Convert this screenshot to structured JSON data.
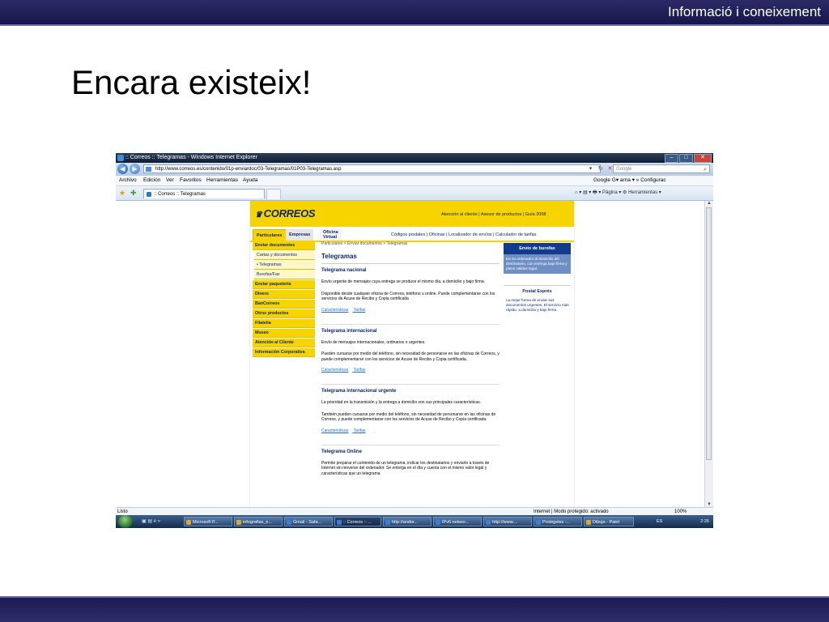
{
  "slide": {
    "header_title": "Informació i coneixement",
    "heading": "Encara existeix!"
  },
  "window": {
    "title": ":: Correos :: Telegramas - Windows Internet Explorer",
    "url": "http://www.correos.es/contenido/01p-enviardoc/03-Telegramas/01P03-Telegramas.asp",
    "search_placeholder": "Google"
  },
  "menu": {
    "items": [
      "Archivo",
      "Edición",
      "Ver",
      "Favoritos",
      "Herramientas",
      "Ayuda"
    ],
    "google_bar": "Google  G▾ arna ▾  »  Configurac"
  },
  "tab": {
    "label": ":: Correos :: Telegramas"
  },
  "command_bar": {
    "text": "⌂ ▾  ▤ ▾  🖶 ▾  Página ▾  ⚙ Herramientas ▾"
  },
  "correos": {
    "logo": "CORREOS",
    "top_links": "Atención al cliente  |  Asesor de productos  |  Guía 2008",
    "tabs": {
      "particulares": "Particulares",
      "empresas": "Empresas",
      "oficina_virtual_1": "Oficina",
      "oficina_virtual_2": "Virtual"
    },
    "sub_links": "Códigos postales  |  Oficinas  |  Localizador de envíos  |  Calculador de tarifas",
    "left_menu": [
      "Enviar documentos",
      "Cartas y documentos",
      "• Telegramas",
      "Burofax/Fax",
      "Enviar paquetería",
      "Dinero",
      "BanCorreos",
      "Otros productos",
      "Filatelia",
      "Museo",
      "Atención al Cliente",
      "Información Corporativa"
    ],
    "breadcrumb": "Particulares > Enviar documentos > Telegramas",
    "page_title": "Telegramas",
    "sections": {
      "nacional": {
        "title": "Telegrama nacional",
        "p1": "Envío urgente de mensajes cuya entrega se produce el mismo día, a domicilio y bajo firma.",
        "p2": "Disponible desde cualquier oficina de Correos, teléfono u online. Puede complementarse con los servicios de Acuse de Recibo y Copia certificada",
        "link1": "Características",
        "link2": "Tarifas"
      },
      "internacional": {
        "title": "Telegrama internacional",
        "p1": "Envío de mensajes internacionales, ordinarios o urgentes.",
        "p2": "Pueden cursarse por medio del teléfono, sin necesidad de personarse en las oficinas de Correos, y puede complementarse con los servicios de Acuse de Recibo y Copia certificada.",
        "link1": "Características",
        "link2": "Tarifas"
      },
      "urgente": {
        "title": "Telegrama internacional urgente",
        "p1": "La prioridad en la transmisión y la entrega a domicilio son sus principales características.",
        "p2": "También pueden cursarse por medio del teléfono, sin necesidad de personarse en las oficinas de Correos, y puede complementarse con los servicios de Acuse de Recibo y Copia certificada.",
        "link1": "Características",
        "link2": "Tarifas"
      },
      "online": {
        "title": "Telegrama Online",
        "p1": "Permite preparar el contenido de un telegrama, indicar los destinatarios y enviarlo a través de Internet sin moverse del ordenador. Se entrega en el día y cuenta con el mismo valor legal y características que un telegrama"
      }
    },
    "burofax": {
      "title": "Envío de burofax",
      "text": "De su ordenador al domicilio del destinatario, con entrega bajo firma y pleno validez legal."
    },
    "postal_expres": {
      "title": "Postal Exprés",
      "text": "La mejor forma de enviar sus documentos urgentes. El servicio más rápido, a domicilio y bajo firma."
    }
  },
  "status": {
    "text": "Listo",
    "zone": "Internet | Modo protegido: activado",
    "zoom": "100%"
  },
  "taskbar": {
    "buttons": [
      "Microsoft P...",
      "infografias_e...",
      "Gmail - Safa...",
      ":: Correos :: ...",
      "http://andor...",
      "IPv6 networ...",
      "http://www....",
      "Protégeles -...",
      "Dibujo - Paint"
    ],
    "lang": "ES",
    "clock": "2:26"
  }
}
